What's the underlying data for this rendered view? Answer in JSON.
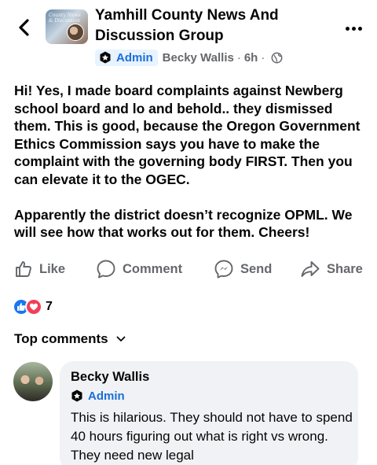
{
  "header": {
    "group_name": "Yamhill County News And Discussion Group",
    "thumbnail_text": "County News & Discussion"
  },
  "post_meta": {
    "role_badge": "Admin",
    "author": "Becky Wallis",
    "separator": "·",
    "time": "6h",
    "separator_2": "·",
    "audience_icon": "globe-icon"
  },
  "post": {
    "paragraph_1": "Hi! Yes, I made board complaints against Newberg school board and lo and behold.. they dismissed them. This is good, because the Oregon Government Ethics Commission says you have to make the complaint with the governing body FIRST. Then you can elevate it to the OGEC.",
    "paragraph_2": "Apparently the district doesn’t recognize OPML. We will see how that works out for them. Cheers!"
  },
  "actions": {
    "like": "Like",
    "comment": "Comment",
    "send": "Send",
    "share": "Share"
  },
  "reactions": {
    "count": "7",
    "types": [
      "like",
      "love"
    ]
  },
  "comments_section": {
    "sort_label": "Top comments"
  },
  "comment": {
    "author": "Becky Wallis",
    "role_badge": "Admin",
    "text": "This is hilarious. They should not have to spend 40 hours figuring out what is right vs wrong. They need new legal"
  },
  "colors": {
    "accent_blue": "#1b6ed6",
    "like_blue": "#1877f2",
    "love_red": "#f33e58",
    "secondary_text": "#65676b",
    "bubble_bg": "#f0f2f5"
  }
}
